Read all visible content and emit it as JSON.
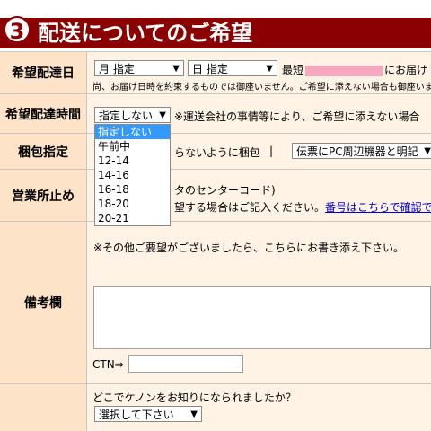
{
  "header": {
    "number": "3",
    "title": "配送についてのご希望"
  },
  "colors": {
    "header_bg": "#8b0000",
    "label_bg": "#fde3c8",
    "cell_bg": "#fff3e6",
    "dropdown_active": "#3399ff"
  },
  "rows": {
    "delivery_date": {
      "label": "希望配達日",
      "month_select": "月 指定",
      "day_select": "日 指定",
      "text_before": "最短",
      "text_after": "にお届け",
      "note": "尚、お届け日時を約束するものでは御座いません。ご希望に添えない場合も御座いま"
    },
    "delivery_time": {
      "label": "希望配達時間",
      "selected": "指定しない",
      "note": "※運送会社の事情等により、ご希望に添えない場合",
      "options": [
        "指定しない",
        "午前中",
        "12-14",
        "14-16",
        "16-18",
        "18-20",
        "20-21"
      ]
    },
    "packing": {
      "label": "梱包指定",
      "text": "らないように梱包",
      "separator": "|",
      "invoice_select": "伝票にPC周辺機器と明記"
    },
    "office_stop": {
      "label": "営業所止め",
      "line1": "タのセンターコード)",
      "line2_text": "望する場合はご記入ください。",
      "line2_link": "番号はこちらで確認で"
    },
    "remarks": {
      "label": "備考欄",
      "instruction": "※その他ご要望がございましたら、こちらにお書き添え下さい。",
      "ctn_label": "CTN⇒"
    },
    "source": {
      "question": "どこでケノンをお知りになられましたか？",
      "select": "選択して下さい"
    }
  }
}
